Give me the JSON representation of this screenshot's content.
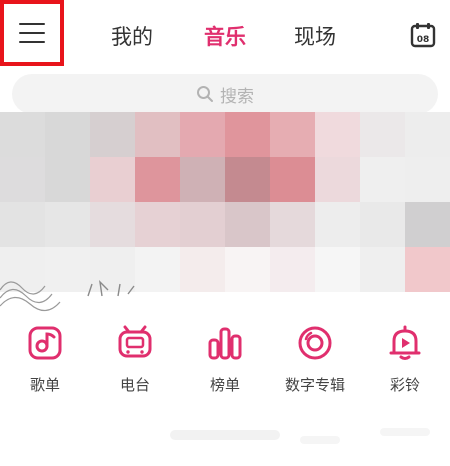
{
  "header": {
    "menu_icon": "menu-icon",
    "tabs": [
      {
        "label": "我的",
        "active": false
      },
      {
        "label": "音乐",
        "active": true
      },
      {
        "label": "现场",
        "active": false
      }
    ],
    "calendar_icon": "calendar-icon",
    "calendar_day": "08"
  },
  "search": {
    "icon": "search-icon",
    "placeholder": "搜索"
  },
  "banner": {
    "tiles": [
      "#dcdcdc",
      "#d8d8d8",
      "#d6cfd0",
      "#e1bfc2",
      "#e4a9b0",
      "#e0959c",
      "#e6adb2",
      "#f0dadd",
      "#ebe8e9",
      "#ededed",
      "#dddcdd",
      "#d8d8d8",
      "#e9cfd2",
      "#de959c",
      "#cfb1b5",
      "#c48a90",
      "#dc8d94",
      "#ecd9dc",
      "#efefef",
      "#eeeeee",
      "#e3e3e3",
      "#e6e6e6",
      "#e5dcde",
      "#e6d1d4",
      "#e3cfd2",
      "#d9c6c9",
      "#e5d9db",
      "#ededed",
      "#e9e9e9",
      "#d0cfd0",
      "#efefef",
      "#f0f0f0",
      "#efefef",
      "#f3f3f3",
      "#f4ecec",
      "#f8f4f4",
      "#f4ecee",
      "#f6f6f6",
      "#efefef",
      "#f1c8cb",
      "#ffffff",
      "#ffffff",
      "#ffffff",
      "#ffffff",
      "#ffffff",
      "#ffffff",
      "#ffffff",
      "#ffffff",
      "#ffffff",
      "#ffffff"
    ]
  },
  "nav": [
    {
      "label": "歌单",
      "icon": "playlist-icon"
    },
    {
      "label": "电台",
      "icon": "radio-icon"
    },
    {
      "label": "榜单",
      "icon": "chart-bars-icon"
    },
    {
      "label": "数字专辑",
      "icon": "disc-icon"
    },
    {
      "label": "彩铃",
      "icon": "ringtone-bell-icon"
    }
  ],
  "colors": {
    "accent": "#e02f6e",
    "highlight_border": "#e8141b"
  }
}
